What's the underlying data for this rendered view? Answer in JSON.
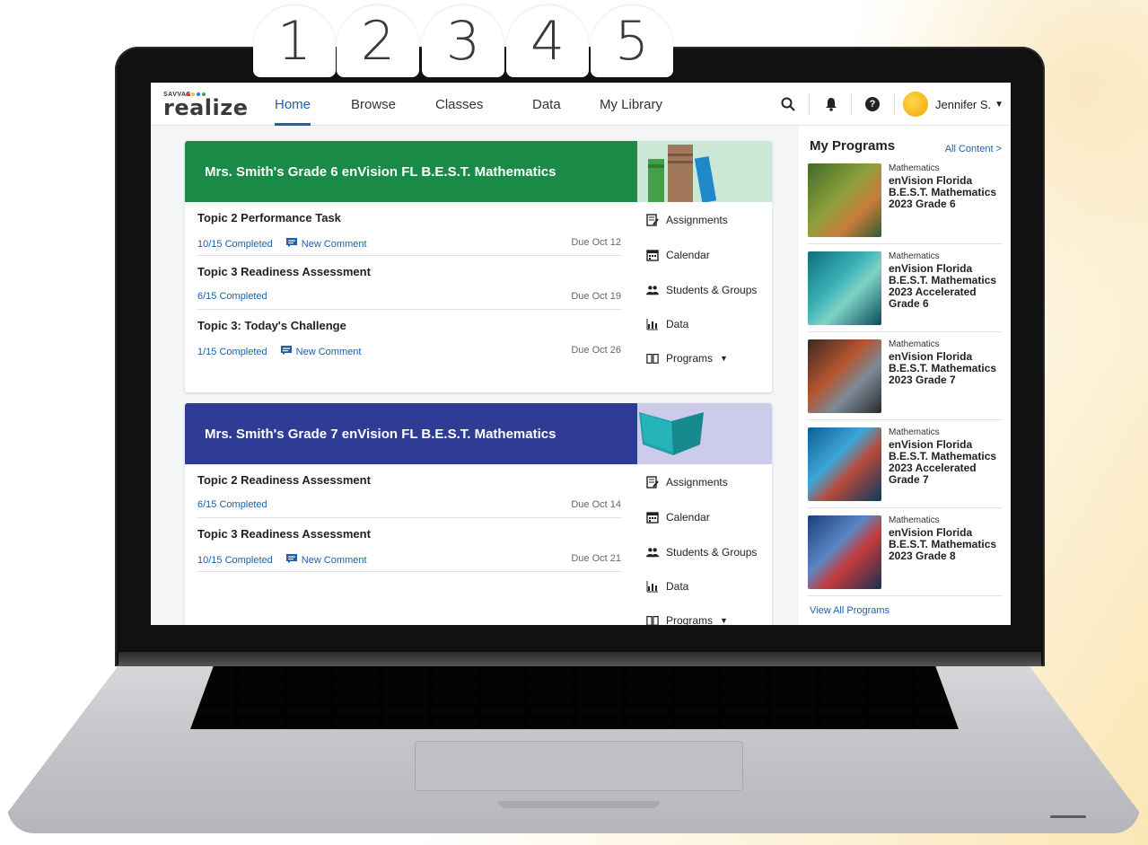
{
  "badges": [
    "1",
    "2",
    "3",
    "4",
    "5"
  ],
  "logo": {
    "small": "SAVVAS",
    "big": "realize",
    "tm": "TM"
  },
  "nav": {
    "tabs": [
      {
        "label": "Home"
      },
      {
        "label": "Browse"
      },
      {
        "label": "Classes"
      },
      {
        "label": "Data"
      },
      {
        "label": "My Library"
      }
    ]
  },
  "header": {
    "user_name": "Jennifer S."
  },
  "cards": [
    {
      "title": "Mrs. Smith's Grade 6 enVision FL B.E.S.T. Mathematics",
      "color": "#1a8a47",
      "assignments": [
        {
          "title": "Topic 2 Performance Task",
          "progress": "10/15 Completed",
          "comment": "New Comment",
          "due": "Due Oct 12"
        },
        {
          "title": "Topic 3 Readiness Assessment",
          "progress": "6/15 Completed",
          "comment": "",
          "due": "Due Oct 19"
        },
        {
          "title": "Topic 3: Today's Challenge",
          "progress": "1/15 Completed",
          "comment": "New Comment",
          "due": "Due Oct 26"
        }
      ],
      "menu": [
        "Assignments",
        "Calendar",
        "Students & Groups",
        "Data",
        "Programs"
      ]
    },
    {
      "title": "Mrs. Smith's Grade 7 enVision FL B.E.S.T. Mathematics",
      "color": "#2e3c96",
      "assignments": [
        {
          "title": "Topic 2 Readiness Assessment",
          "progress": "6/15 Completed",
          "comment": "",
          "due": "Due Oct 14"
        },
        {
          "title": "Topic 3 Readiness Assessment",
          "progress": "10/15 Completed",
          "comment": "New Comment",
          "due": "Due Oct 21"
        }
      ],
      "menu": [
        "Assignments",
        "Calendar",
        "Students & Groups",
        "Data",
        "Programs"
      ]
    }
  ],
  "programs": {
    "title": "My Programs",
    "all_content": "All Content >",
    "view_all": "View All Programs",
    "items": [
      {
        "subject": "Mathematics",
        "name": "enVision Florida B.E.S.T. Mathematics 2023 Grade 6"
      },
      {
        "subject": "Mathematics",
        "name": "enVision Florida B.E.S.T. Mathematics 2023 Accelerated Grade 6"
      },
      {
        "subject": "Mathematics",
        "name": "enVision Florida B.E.S.T. Mathematics 2023 Grade 7"
      },
      {
        "subject": "Mathematics",
        "name": "enVision Florida B.E.S.T. Mathematics 2023 Accelerated Grade 7"
      },
      {
        "subject": "Mathematics",
        "name": "enVision Florida B.E.S.T. Mathematics 2023 Grade 8"
      }
    ]
  },
  "colors": {
    "accent": "#1f5fa8",
    "grade6": "#1a8a47",
    "grade7": "#2e3c96"
  }
}
